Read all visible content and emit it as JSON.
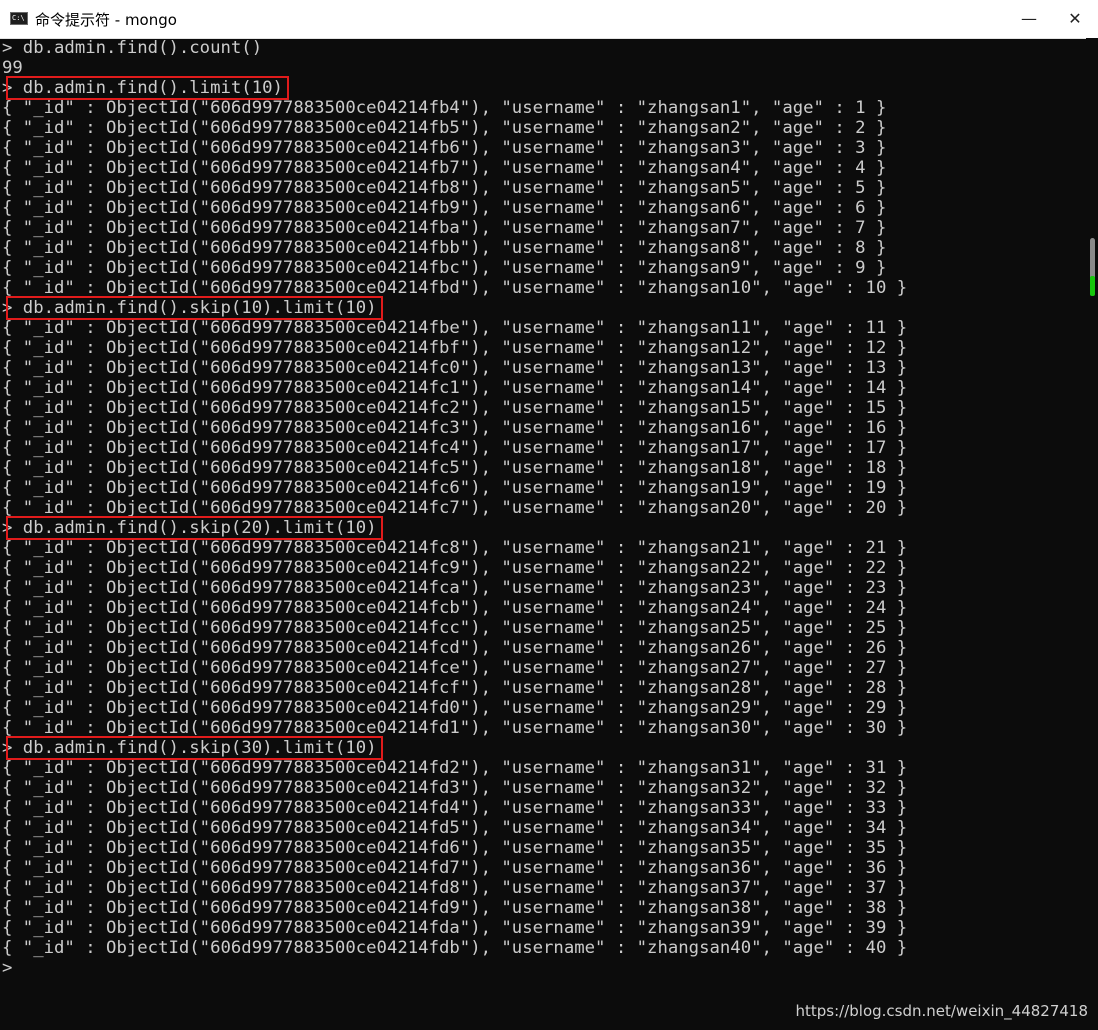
{
  "window": {
    "title": "命令提示符 - mongo",
    "icon": "cmd-icon",
    "icon_text": "C:\\",
    "minimize_label": "—",
    "close_label": "✕"
  },
  "console": {
    "lines": [
      {
        "text": "> db.admin.find().count()",
        "type": "command"
      },
      {
        "text": "99",
        "type": "output"
      },
      {
        "text": "> db.admin.find().limit(10)",
        "type": "command",
        "highlighted": true
      },
      {
        "text": "{ \"_id\" : ObjectId(\"606d9977883500ce04214fb4\"), \"username\" : \"zhangsan1\", \"age\" : 1 }",
        "type": "output"
      },
      {
        "text": "{ \"_id\" : ObjectId(\"606d9977883500ce04214fb5\"), \"username\" : \"zhangsan2\", \"age\" : 2 }",
        "type": "output"
      },
      {
        "text": "{ \"_id\" : ObjectId(\"606d9977883500ce04214fb6\"), \"username\" : \"zhangsan3\", \"age\" : 3 }",
        "type": "output"
      },
      {
        "text": "{ \"_id\" : ObjectId(\"606d9977883500ce04214fb7\"), \"username\" : \"zhangsan4\", \"age\" : 4 }",
        "type": "output"
      },
      {
        "text": "{ \"_id\" : ObjectId(\"606d9977883500ce04214fb8\"), \"username\" : \"zhangsan5\", \"age\" : 5 }",
        "type": "output"
      },
      {
        "text": "{ \"_id\" : ObjectId(\"606d9977883500ce04214fb9\"), \"username\" : \"zhangsan6\", \"age\" : 6 }",
        "type": "output"
      },
      {
        "text": "{ \"_id\" : ObjectId(\"606d9977883500ce04214fba\"), \"username\" : \"zhangsan7\", \"age\" : 7 }",
        "type": "output"
      },
      {
        "text": "{ \"_id\" : ObjectId(\"606d9977883500ce04214fbb\"), \"username\" : \"zhangsan8\", \"age\" : 8 }",
        "type": "output"
      },
      {
        "text": "{ \"_id\" : ObjectId(\"606d9977883500ce04214fbc\"), \"username\" : \"zhangsan9\", \"age\" : 9 }",
        "type": "output"
      },
      {
        "text": "{ \"_id\" : ObjectId(\"606d9977883500ce04214fbd\"), \"username\" : \"zhangsan10\", \"age\" : 10 }",
        "type": "output"
      },
      {
        "text": "> db.admin.find().skip(10).limit(10)",
        "type": "command",
        "highlighted": true
      },
      {
        "text": "{ \"_id\" : ObjectId(\"606d9977883500ce04214fbe\"), \"username\" : \"zhangsan11\", \"age\" : 11 }",
        "type": "output"
      },
      {
        "text": "{ \"_id\" : ObjectId(\"606d9977883500ce04214fbf\"), \"username\" : \"zhangsan12\", \"age\" : 12 }",
        "type": "output"
      },
      {
        "text": "{ \"_id\" : ObjectId(\"606d9977883500ce04214fc0\"), \"username\" : \"zhangsan13\", \"age\" : 13 }",
        "type": "output"
      },
      {
        "text": "{ \"_id\" : ObjectId(\"606d9977883500ce04214fc1\"), \"username\" : \"zhangsan14\", \"age\" : 14 }",
        "type": "output"
      },
      {
        "text": "{ \"_id\" : ObjectId(\"606d9977883500ce04214fc2\"), \"username\" : \"zhangsan15\", \"age\" : 15 }",
        "type": "output"
      },
      {
        "text": "{ \"_id\" : ObjectId(\"606d9977883500ce04214fc3\"), \"username\" : \"zhangsan16\", \"age\" : 16 }",
        "type": "output"
      },
      {
        "text": "{ \"_id\" : ObjectId(\"606d9977883500ce04214fc4\"), \"username\" : \"zhangsan17\", \"age\" : 17 }",
        "type": "output"
      },
      {
        "text": "{ \"_id\" : ObjectId(\"606d9977883500ce04214fc5\"), \"username\" : \"zhangsan18\", \"age\" : 18 }",
        "type": "output"
      },
      {
        "text": "{ \"_id\" : ObjectId(\"606d9977883500ce04214fc6\"), \"username\" : \"zhangsan19\", \"age\" : 19 }",
        "type": "output"
      },
      {
        "text": "{ \"_id\" : ObjectId(\"606d9977883500ce04214fc7\"), \"username\" : \"zhangsan20\", \"age\" : 20 }",
        "type": "output"
      },
      {
        "text": "> db.admin.find().skip(20).limit(10)",
        "type": "command",
        "highlighted": true
      },
      {
        "text": "{ \"_id\" : ObjectId(\"606d9977883500ce04214fc8\"), \"username\" : \"zhangsan21\", \"age\" : 21 }",
        "type": "output"
      },
      {
        "text": "{ \"_id\" : ObjectId(\"606d9977883500ce04214fc9\"), \"username\" : \"zhangsan22\", \"age\" : 22 }",
        "type": "output"
      },
      {
        "text": "{ \"_id\" : ObjectId(\"606d9977883500ce04214fca\"), \"username\" : \"zhangsan23\", \"age\" : 23 }",
        "type": "output"
      },
      {
        "text": "{ \"_id\" : ObjectId(\"606d9977883500ce04214fcb\"), \"username\" : \"zhangsan24\", \"age\" : 24 }",
        "type": "output"
      },
      {
        "text": "{ \"_id\" : ObjectId(\"606d9977883500ce04214fcc\"), \"username\" : \"zhangsan25\", \"age\" : 25 }",
        "type": "output"
      },
      {
        "text": "{ \"_id\" : ObjectId(\"606d9977883500ce04214fcd\"), \"username\" : \"zhangsan26\", \"age\" : 26 }",
        "type": "output"
      },
      {
        "text": "{ \"_id\" : ObjectId(\"606d9977883500ce04214fce\"), \"username\" : \"zhangsan27\", \"age\" : 27 }",
        "type": "output"
      },
      {
        "text": "{ \"_id\" : ObjectId(\"606d9977883500ce04214fcf\"), \"username\" : \"zhangsan28\", \"age\" : 28 }",
        "type": "output"
      },
      {
        "text": "{ \"_id\" : ObjectId(\"606d9977883500ce04214fd0\"), \"username\" : \"zhangsan29\", \"age\" : 29 }",
        "type": "output"
      },
      {
        "text": "{ \"_id\" : ObjectId(\"606d9977883500ce04214fd1\"), \"username\" : \"zhangsan30\", \"age\" : 30 }",
        "type": "output"
      },
      {
        "text": "> db.admin.find().skip(30).limit(10)",
        "type": "command",
        "highlighted": true
      },
      {
        "text": "{ \"_id\" : ObjectId(\"606d9977883500ce04214fd2\"), \"username\" : \"zhangsan31\", \"age\" : 31 }",
        "type": "output"
      },
      {
        "text": "{ \"_id\" : ObjectId(\"606d9977883500ce04214fd3\"), \"username\" : \"zhangsan32\", \"age\" : 32 }",
        "type": "output"
      },
      {
        "text": "{ \"_id\" : ObjectId(\"606d9977883500ce04214fd4\"), \"username\" : \"zhangsan33\", \"age\" : 33 }",
        "type": "output"
      },
      {
        "text": "{ \"_id\" : ObjectId(\"606d9977883500ce04214fd5\"), \"username\" : \"zhangsan34\", \"age\" : 34 }",
        "type": "output"
      },
      {
        "text": "{ \"_id\" : ObjectId(\"606d9977883500ce04214fd6\"), \"username\" : \"zhangsan35\", \"age\" : 35 }",
        "type": "output"
      },
      {
        "text": "{ \"_id\" : ObjectId(\"606d9977883500ce04214fd7\"), \"username\" : \"zhangsan36\", \"age\" : 36 }",
        "type": "output"
      },
      {
        "text": "{ \"_id\" : ObjectId(\"606d9977883500ce04214fd8\"), \"username\" : \"zhangsan37\", \"age\" : 37 }",
        "type": "output"
      },
      {
        "text": "{ \"_id\" : ObjectId(\"606d9977883500ce04214fd9\"), \"username\" : \"zhangsan38\", \"age\" : 38 }",
        "type": "output"
      },
      {
        "text": "{ \"_id\" : ObjectId(\"606d9977883500ce04214fda\"), \"username\" : \"zhangsan39\", \"age\" : 39 }",
        "type": "output"
      },
      {
        "text": "{ \"_id\" : ObjectId(\"606d9977883500ce04214fdb\"), \"username\" : \"zhangsan40\", \"age\" : 40 }",
        "type": "output"
      },
      {
        "text": ">",
        "type": "prompt"
      }
    ]
  },
  "watermark": "https://blog.csdn.net/weixin_44827418",
  "colors": {
    "background": "#0c0c0c",
    "text": "#cccccc",
    "highlight_box": "#e11b1b",
    "scroll_marker": "#16c60c"
  }
}
